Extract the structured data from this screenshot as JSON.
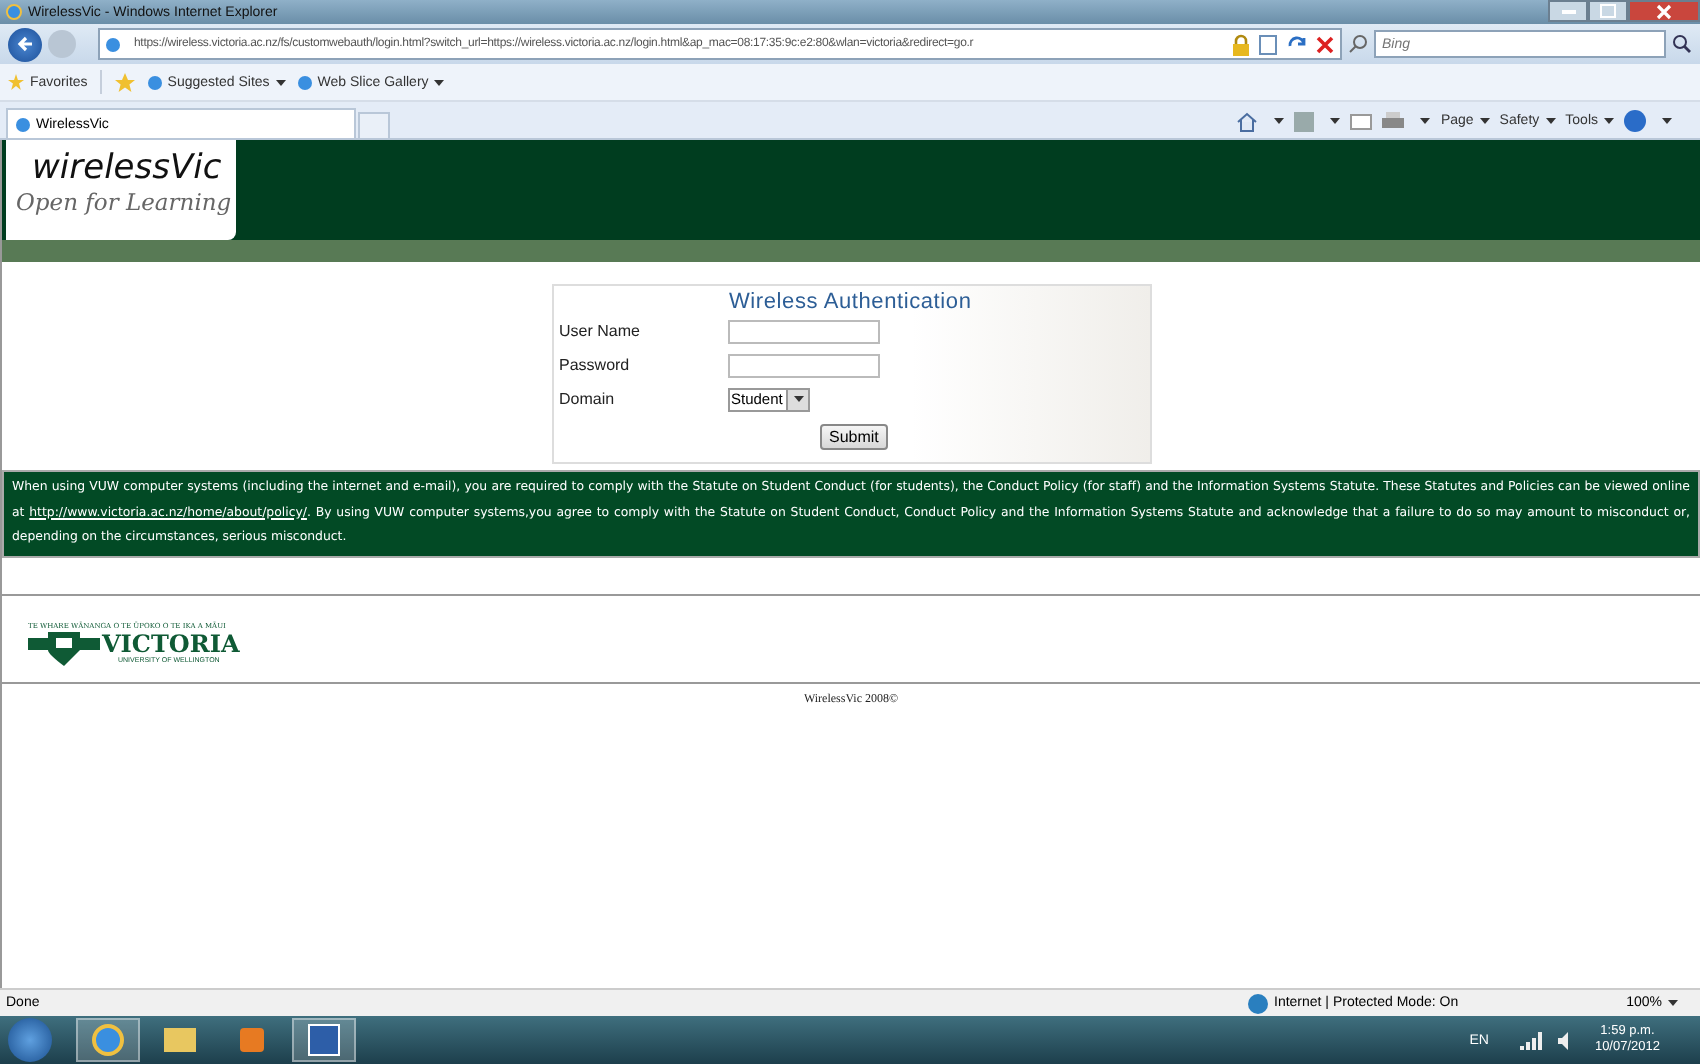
{
  "window": {
    "title": "WirelessVic - Windows Internet Explorer"
  },
  "address_bar": {
    "url": "https://wireless.victoria.ac.nz/fs/customwebauth/login.html?switch_url=https://wireless.victoria.ac.nz/login.html&ap_mac=08:17:35:9c:e2:80&wlan=victoria&redirect=go.r",
    "search_placeholder": "Bing"
  },
  "favorites_bar": {
    "favorites": "Favorites",
    "items": [
      {
        "label": "Suggested Sites"
      },
      {
        "label": "Web Slice Gallery"
      }
    ]
  },
  "tabs": [
    {
      "label": "WirelessVic",
      "selected": true
    }
  ],
  "command_bar": [
    "Page",
    "Safety",
    "Tools"
  ],
  "header": {
    "title": "wirelessVic",
    "tagline": "Open for Learning"
  },
  "login": {
    "title": "Wireless Authentication",
    "fields": [
      {
        "kind": "text",
        "label": "User Name"
      },
      {
        "kind": "password",
        "label": "Password"
      },
      {
        "kind": "select",
        "label": "Domain",
        "value": "Student"
      }
    ],
    "submit": "Submit"
  },
  "notice": {
    "before": "When using VUW computer systems (including the internet and e-mail), you are required to comply with the Statute on Student Conduct (for students), the Conduct Policy (for staff) and the Information Systems Statute. These Statutes and Policies can be viewed online at ",
    "link": "http://www.victoria.ac.nz/home/about/policy/",
    "after": ". By using VUW computer systems,you agree to comply with the Statute on Student Conduct, Conduct Policy and the Information Systems Statute and acknowledge that a failure to do so may amount to misconduct or, depending on the circumstances, serious misconduct."
  },
  "university_logo": {
    "motto": "TE WHARE WĀNANGA O TE ŪPOKO O TE IKA A MĀUI",
    "name": "VICTORIA",
    "subtitle": "UNIVERSITY OF WELLINGTON"
  },
  "footer": "WirelessVic 2008©",
  "status_bar": {
    "status": "Done",
    "zone": "Internet | Protected Mode: On",
    "zoom": "100%"
  },
  "taskbar": {
    "language": "EN",
    "time": "1:59 p.m.",
    "date": "10/07/2012"
  }
}
